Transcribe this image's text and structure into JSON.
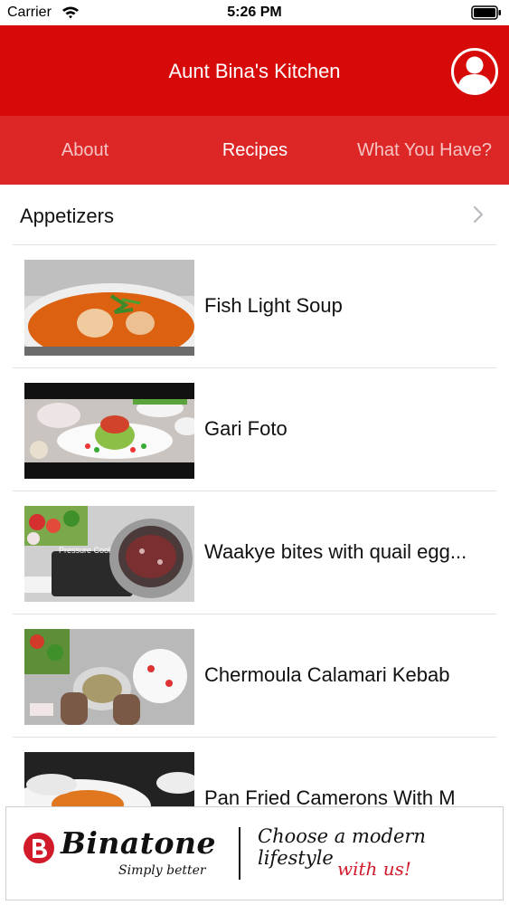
{
  "status_bar": {
    "carrier": "Carrier",
    "time": "5:26 PM"
  },
  "nav": {
    "title": "Aunt Bina's Kitchen"
  },
  "tabs": [
    {
      "label": "About"
    },
    {
      "label": "Recipes"
    },
    {
      "label": "What You Have?"
    }
  ],
  "section": {
    "label": "Appetizers"
  },
  "recipes": [
    {
      "title": "Fish Light Soup"
    },
    {
      "title": "Gari Foto"
    },
    {
      "title": "Waakye bites with quail egg..."
    },
    {
      "title": "Chermoula Calamari Kebab"
    },
    {
      "title": "Pan Fried Camerons With M"
    }
  ],
  "thumb_overlay": {
    "pressure_cook": "Pressure Cook"
  },
  "ad": {
    "brand": "Binatone",
    "subtitle": "Simply better",
    "tagline": "Choose a modern lifestyle",
    "tagline2": "with us!"
  },
  "colors": {
    "nav_red": "#d70a0a",
    "tab_red": "#dd2727",
    "ad_red": "#d11b2a"
  }
}
